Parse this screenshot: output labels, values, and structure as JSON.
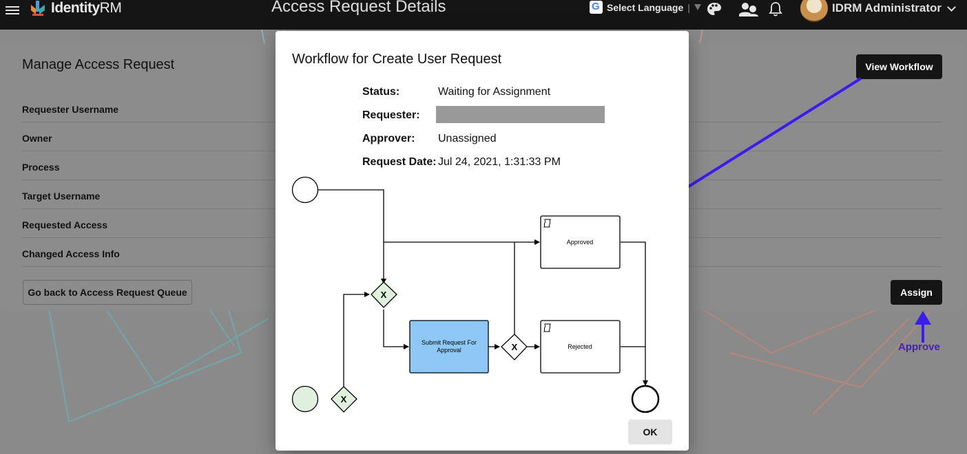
{
  "header": {
    "logo_text_bold": "Identity",
    "logo_text_light": "RM",
    "page_title": "Access Request Details",
    "language_label": "Select Language",
    "language_separator": "|",
    "user_name": "IDRM Administrator"
  },
  "card": {
    "title": "Manage Access Request",
    "fields": [
      "Requester Username",
      "Owner",
      "Process",
      "Target Username",
      "Requested Access",
      "Changed Access Info"
    ],
    "view_workflow_label": "View Workflow",
    "back_label": "Go back to Access Request Queue",
    "assign_label": "Assign"
  },
  "annotation": {
    "approve_label": "Approve",
    "arrow_color": "#3a1cf0",
    "approve_color": "#4a1fb4"
  },
  "modal": {
    "title": "Workflow for Create User Request",
    "status_label": "Status:",
    "status_value": "Waiting for Assignment",
    "requester_label": "Requester:",
    "approver_label": "Approver:",
    "approver_value": "Unassigned",
    "request_date_label": "Request Date:",
    "request_date_value": "Jul 24, 2021, 1:31:33 PM",
    "ok_label": "OK"
  },
  "workflow": {
    "task_submit": [
      "Submit Request For",
      "Approval"
    ],
    "task_approved": "Approved",
    "task_rejected": "Rejected",
    "gateway_symbol": "X",
    "task_color": "#8ec9f5",
    "gateway_color": "#dff0df",
    "start_color": "#dff0df"
  }
}
